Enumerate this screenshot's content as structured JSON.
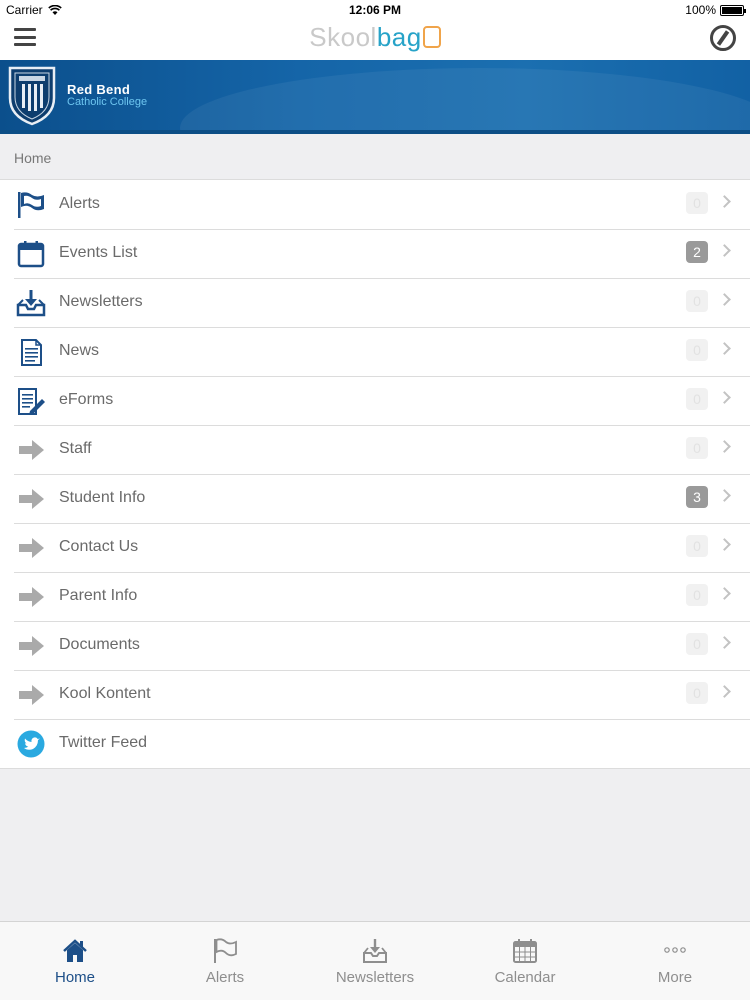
{
  "status_bar": {
    "carrier": "Carrier",
    "time": "12:06 PM",
    "battery": "100%"
  },
  "app_header": {
    "logo_part_1": "Skool",
    "logo_part_2": "bag"
  },
  "banner": {
    "school_name_line1": "Red Bend",
    "school_name_line2": "Catholic College"
  },
  "breadcrumb": "Home",
  "menu": {
    "items": [
      {
        "label": "Alerts",
        "icon": "flag-icon",
        "badge": "0"
      },
      {
        "label": "Events List",
        "icon": "calendar-icon",
        "badge": "2"
      },
      {
        "label": "Newsletters",
        "icon": "inbox-download-icon",
        "badge": "0"
      },
      {
        "label": "News",
        "icon": "document-icon",
        "badge": "0"
      },
      {
        "label": "eForms",
        "icon": "form-edit-icon",
        "badge": "0"
      },
      {
        "label": "Staff",
        "icon": "arrow-right-icon",
        "badge": "0"
      },
      {
        "label": "Student Info",
        "icon": "arrow-right-icon",
        "badge": "3"
      },
      {
        "label": "Contact Us",
        "icon": "arrow-right-icon",
        "badge": "0"
      },
      {
        "label": "Parent Info",
        "icon": "arrow-right-icon",
        "badge": "0"
      },
      {
        "label": "Documents",
        "icon": "arrow-right-icon",
        "badge": "0"
      },
      {
        "label": "Kool Kontent",
        "icon": "arrow-right-icon",
        "badge": "0"
      },
      {
        "label": "Twitter Feed",
        "icon": "twitter-icon"
      }
    ]
  },
  "tab_bar": {
    "tabs": [
      {
        "label": "Home",
        "icon": "home-icon",
        "active": true
      },
      {
        "label": "Alerts",
        "icon": "flag-icon"
      },
      {
        "label": "Newsletters",
        "icon": "inbox-download-icon"
      },
      {
        "label": "Calendar",
        "icon": "calendar-icon"
      },
      {
        "label": "More",
        "icon": "more-dots-icon"
      }
    ]
  },
  "colors": {
    "accent": "#1d4f88",
    "banner": "#1565a8",
    "logo_blue": "#27a3c8",
    "logo_orange": "#f0a44a"
  }
}
